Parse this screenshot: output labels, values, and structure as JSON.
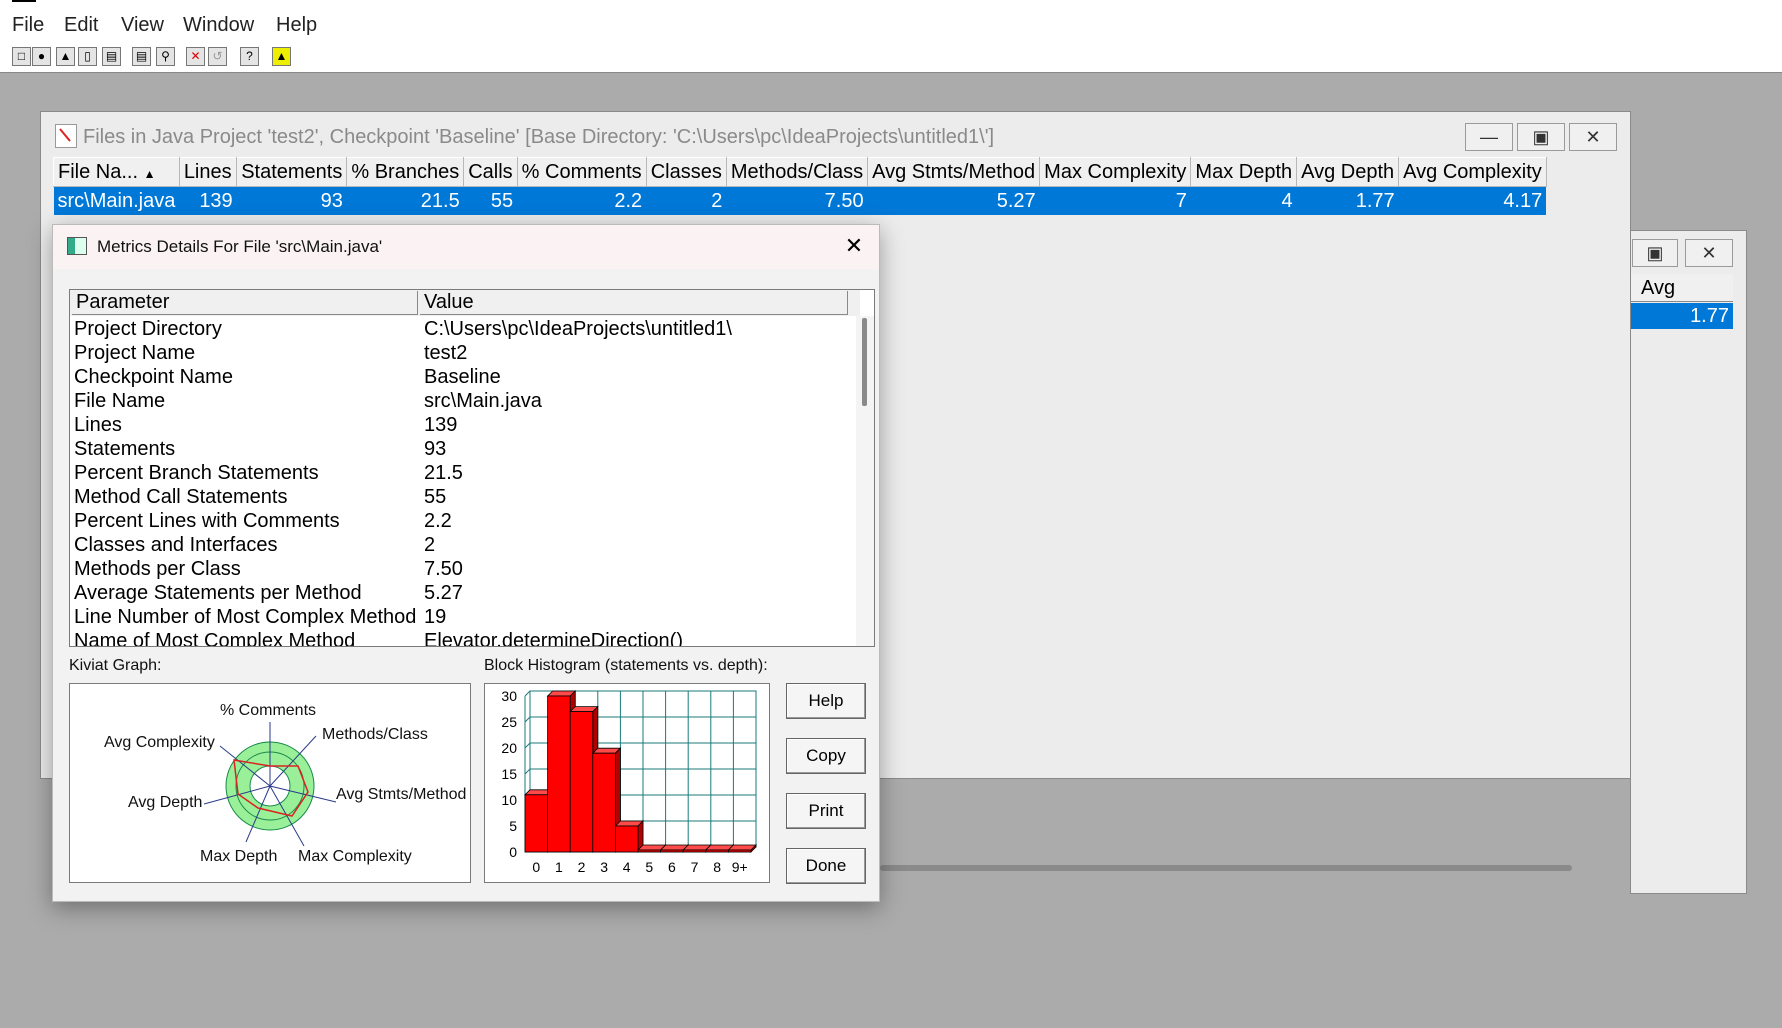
{
  "menu": [
    "File",
    "Edit",
    "View",
    "Window",
    "Help"
  ],
  "toolbar_icons": [
    "new-file-icon",
    "record-icon",
    "folders-icon",
    "open-folder-icon",
    "save-icon",
    "print-icon",
    "print-preview-icon",
    "delete-icon",
    "refresh-icon",
    "help-pointer-icon",
    "tower-icon"
  ],
  "files_window": {
    "title": "Files in Java Project 'test2', Checkpoint 'Baseline'  [Base Directory: 'C:\\Users\\pc\\IdeaProjects\\untitled1\\']",
    "columns": [
      "File Na...",
      "Lines",
      "Statements",
      "% Branches",
      "Calls",
      "% Comments",
      "Classes",
      "Methods/Class",
      "Avg Stmts/Method",
      "Max Complexity",
      "Max Depth",
      "Avg Depth",
      "Avg Complexity"
    ],
    "row": [
      "src\\Main.java",
      "139",
      "93",
      "21.5",
      "55",
      "2.2",
      "2",
      "7.50",
      "5.27",
      "7",
      "4",
      "1.77",
      "4.17"
    ]
  },
  "back_window": {
    "column": "Avg Depth",
    "value": "1.77"
  },
  "dialog": {
    "title": "Metrics Details For File 'src\\Main.java'",
    "headers": {
      "param": "Parameter",
      "value": "Value"
    },
    "rows": [
      {
        "param": "Project Directory",
        "value": "C:\\Users\\pc\\IdeaProjects\\untitled1\\"
      },
      {
        "param": "Project Name",
        "value": "test2"
      },
      {
        "param": "Checkpoint Name",
        "value": "Baseline"
      },
      {
        "param": "File Name",
        "value": "src\\Main.java"
      },
      {
        "param": "Lines",
        "value": "139"
      },
      {
        "param": "Statements",
        "value": "93"
      },
      {
        "param": "Percent Branch Statements",
        "value": "21.5"
      },
      {
        "param": "Method Call Statements",
        "value": "55"
      },
      {
        "param": "Percent Lines with Comments",
        "value": "2.2"
      },
      {
        "param": "Classes and Interfaces",
        "value": "2"
      },
      {
        "param": "Methods per Class",
        "value": "7.50"
      },
      {
        "param": "Average Statements per Method",
        "value": "5.27"
      },
      {
        "param": "Line Number of Most Complex Method",
        "value": "19"
      },
      {
        "param": "Name of Most Complex Method",
        "value": "Elevator.determineDirection()"
      }
    ],
    "kiviat_label": "Kiviat Graph:",
    "kiviat_axes": [
      "% Comments",
      "Methods/Class",
      "Avg Stmts/Method",
      "Max Complexity",
      "Max Depth",
      "Avg Depth",
      "Avg Complexity"
    ],
    "histogram_label": "Block Histogram (statements vs. depth):",
    "buttons": {
      "help": "Help",
      "copy": "Copy",
      "print": "Print",
      "done": "Done"
    }
  },
  "chart_data": {
    "type": "bar",
    "title": "Block Histogram (statements vs. depth):",
    "categories": [
      "0",
      "1",
      "2",
      "3",
      "4",
      "5",
      "6",
      "7",
      "8",
      "9+"
    ],
    "values": [
      11,
      30,
      27,
      19,
      5,
      0,
      0,
      0,
      0,
      0
    ],
    "yticks": [
      "0",
      "5",
      "10",
      "15",
      "20",
      "25",
      "30"
    ],
    "ylim": [
      0,
      30
    ],
    "bar_color": "#ff0000",
    "grid_color": "#1a7a7a"
  },
  "colors": {
    "selection": "#0078d7",
    "kiviat_ring": "#99f099"
  }
}
